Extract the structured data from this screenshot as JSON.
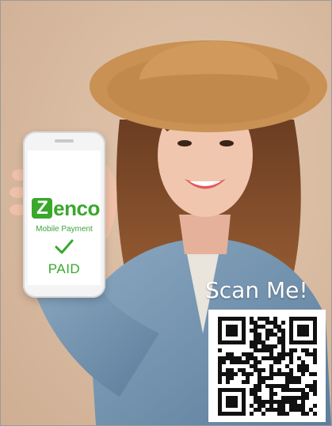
{
  "phone": {
    "brand": "Zenco",
    "subtitle": "Mobile Payment",
    "status": "PAID"
  },
  "qr_label": "Scan Me!",
  "colors": {
    "brand_green": "#39a82b",
    "background": "#d9bca2",
    "hat": "#c99154",
    "jacket": "#6f8fab"
  },
  "icons": {
    "checkmark": "check-icon",
    "qr": "qr-code-icon"
  }
}
